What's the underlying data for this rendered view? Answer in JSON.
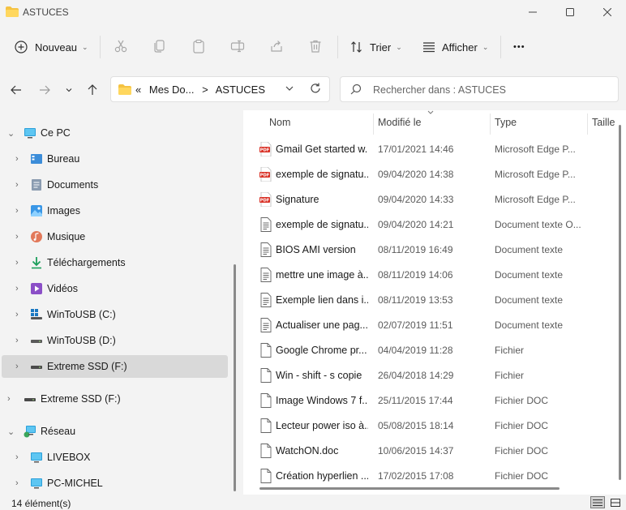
{
  "window": {
    "title": "ASTUCES"
  },
  "toolbar": {
    "new_label": "Nouveau",
    "sort_label": "Trier",
    "view_label": "Afficher",
    "more_label": "•••"
  },
  "address": {
    "overflow": "«",
    "crumbs": [
      "Mes Do...",
      ">",
      "ASTUCES"
    ]
  },
  "search": {
    "placeholder": "Rechercher dans : ASTUCES"
  },
  "nav": {
    "items": [
      {
        "label": "Ce PC",
        "icon": "monitor-icon",
        "expanded": true
      },
      {
        "label": "Bureau",
        "icon": "desktop-icon"
      },
      {
        "label": "Documents",
        "icon": "documents-icon"
      },
      {
        "label": "Images",
        "icon": "pictures-icon"
      },
      {
        "label": "Musique",
        "icon": "music-icon"
      },
      {
        "label": "Téléchargements",
        "icon": "download-icon"
      },
      {
        "label": "Vidéos",
        "icon": "videos-icon"
      },
      {
        "label": "WinToUSB (C:)",
        "icon": "windows-drive-icon"
      },
      {
        "label": "WinToUSB (D:)",
        "icon": "drive-icon"
      },
      {
        "label": "Extreme SSD (F:)",
        "icon": "drive-icon",
        "selected": true
      },
      {
        "label": "Extreme SSD (F:)",
        "icon": "drive-icon"
      },
      {
        "label": "Réseau",
        "icon": "network-icon",
        "expanded": true
      },
      {
        "label": "LIVEBOX",
        "icon": "monitor-icon"
      },
      {
        "label": "PC-MICHEL",
        "icon": "monitor-icon"
      }
    ]
  },
  "list": {
    "headers": {
      "name": "Nom",
      "modified": "Modifié le",
      "type": "Type",
      "size": "Taille"
    },
    "rows": [
      {
        "name": "Gmail Get started w...",
        "date": "17/01/2021 14:46",
        "type": "Microsoft Edge P...",
        "icon": "pdf"
      },
      {
        "name": "exemple de signatu...",
        "date": "09/04/2020 14:38",
        "type": "Microsoft Edge P...",
        "icon": "pdf"
      },
      {
        "name": "Signature",
        "date": "09/04/2020 14:33",
        "type": "Microsoft Edge P...",
        "icon": "pdf"
      },
      {
        "name": "exemple de signatu...",
        "date": "09/04/2020 14:21",
        "type": "Document texte O...",
        "icon": "text"
      },
      {
        "name": "BIOS AMI version",
        "date": "08/11/2019 16:49",
        "type": "Document texte",
        "icon": "text"
      },
      {
        "name": "mettre une image à...",
        "date": "08/11/2019 14:06",
        "type": "Document texte",
        "icon": "text"
      },
      {
        "name": "Exemple lien dans i...",
        "date": "08/11/2019 13:53",
        "type": "Document texte",
        "icon": "text"
      },
      {
        "name": "Actualiser une pag...",
        "date": "02/07/2019 11:51",
        "type": "Document texte",
        "icon": "text"
      },
      {
        "name": "Google Chrome pr...",
        "date": "04/04/2019 11:28",
        "type": "Fichier",
        "icon": "blank"
      },
      {
        "name": "Win - shift - s copie",
        "date": "26/04/2018 14:29",
        "type": "Fichier",
        "icon": "blank"
      },
      {
        "name": "Image Windows 7 f...",
        "date": "25/11/2015 17:44",
        "type": "Fichier DOC",
        "icon": "blank"
      },
      {
        "name": "Lecteur power iso à...",
        "date": "05/08/2015 18:14",
        "type": "Fichier DOC",
        "icon": "blank"
      },
      {
        "name": "WatchON.doc",
        "date": "10/06/2015 14:37",
        "type": "Fichier DOC",
        "icon": "blank"
      },
      {
        "name": "Création hyperlien ...",
        "date": "17/02/2015 17:08",
        "type": "Fichier DOC",
        "icon": "blank"
      }
    ]
  },
  "status": {
    "count": "14 élément(s)"
  },
  "colors": {
    "folder": "#f5c342",
    "pdf": "#d93025",
    "accent": "#0067c0"
  }
}
